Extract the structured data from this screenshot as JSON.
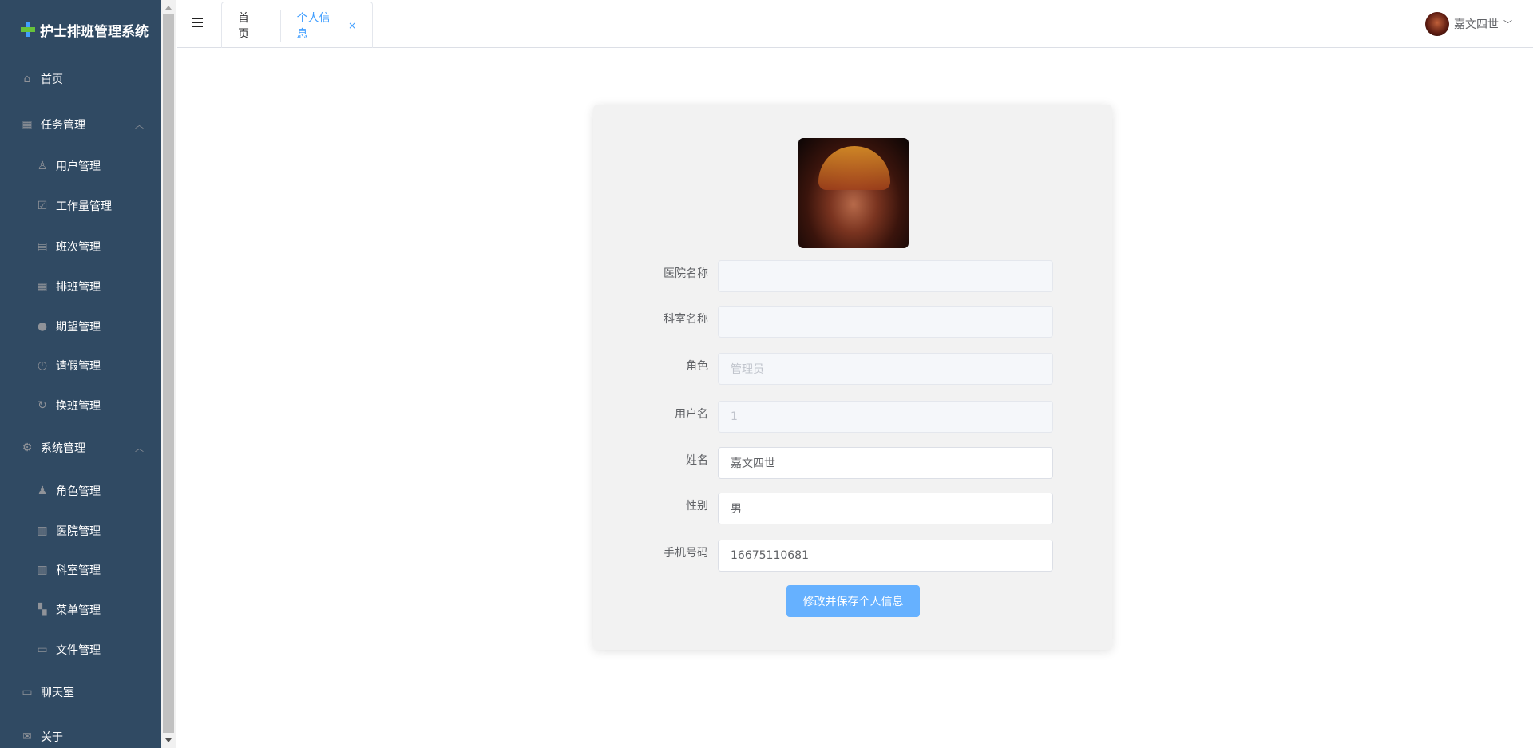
{
  "app": {
    "title": "护士排班管理系统"
  },
  "sidebar": {
    "items": [
      {
        "label": "首页",
        "icon": "home-icon"
      },
      {
        "label": "任务管理",
        "icon": "grid-icon"
      },
      {
        "label": "用户管理",
        "icon": "user-icon"
      },
      {
        "label": "工作量管理",
        "icon": "clipboard-check-icon"
      },
      {
        "label": "班次管理",
        "icon": "clipboard-icon"
      },
      {
        "label": "排班管理",
        "icon": "calendar-icon"
      },
      {
        "label": "期望管理",
        "icon": "lightbulb-icon"
      },
      {
        "label": "请假管理",
        "icon": "clock-icon"
      },
      {
        "label": "换班管理",
        "icon": "refresh-icon"
      },
      {
        "label": "系统管理",
        "icon": "gear-icon"
      },
      {
        "label": "角色管理",
        "icon": "user-filled-icon"
      },
      {
        "label": "医院管理",
        "icon": "building-icon"
      },
      {
        "label": "科室管理",
        "icon": "office-building-icon"
      },
      {
        "label": "菜单管理",
        "icon": "menu-icon"
      },
      {
        "label": "文件管理",
        "icon": "folder-icon"
      },
      {
        "label": "聊天室",
        "icon": "chat-icon"
      },
      {
        "label": "关于",
        "icon": "message-icon"
      }
    ]
  },
  "header": {
    "tabs": [
      {
        "label": "首页"
      },
      {
        "label": "个人信息",
        "close": "×"
      }
    ],
    "user": {
      "name": "嘉文四世"
    }
  },
  "form": {
    "fields": [
      {
        "label": "医院名称",
        "value": "",
        "disabled": true
      },
      {
        "label": "科室名称",
        "value": "",
        "disabled": true
      },
      {
        "label": "角色",
        "value": "管理员",
        "disabled": true
      },
      {
        "label": "用户名",
        "value": "1",
        "disabled": true
      },
      {
        "label": "姓名",
        "value": "嘉文四世",
        "disabled": false
      },
      {
        "label": "性别",
        "value": "男",
        "disabled": false
      },
      {
        "label": "手机号码",
        "value": "16675110681",
        "disabled": false
      }
    ],
    "submit_label": "修改并保存个人信息"
  },
  "colors": {
    "sidebar": "#304a63",
    "accent": "#409eff",
    "button": "#66b1ff"
  }
}
